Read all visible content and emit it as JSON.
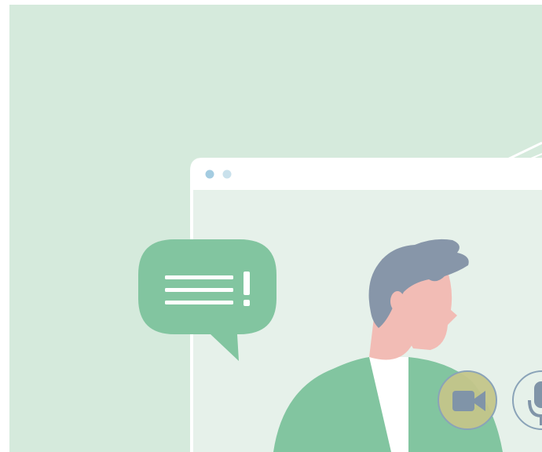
{
  "illustration": {
    "theme": "video call",
    "icons": [
      "chat-bubble-icon",
      "video-camera-icon",
      "microphone-icon"
    ],
    "colors": {
      "background": "#d5eadc",
      "window_frame": "#ffffff",
      "window_body": "#e6f1ea",
      "accent_green": "#82c5a0",
      "hair": "#8796a9",
      "skin": "#f2bcb5",
      "window_dot_1": "#a4cce1",
      "window_dot_2": "#c9e1ec",
      "camera_button": "#c3c58a",
      "icon_fill": "#8094a8"
    }
  }
}
